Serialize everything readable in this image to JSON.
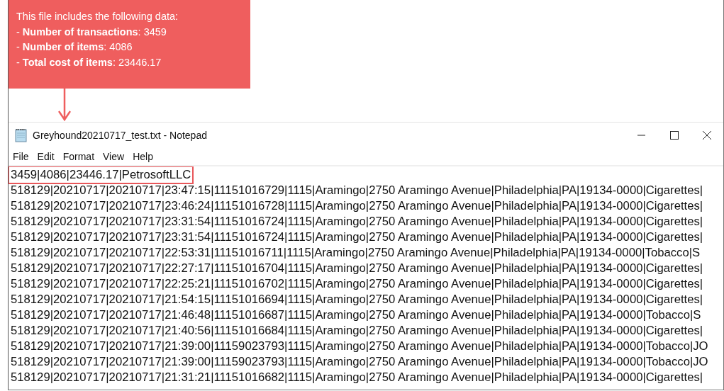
{
  "callout": {
    "heading": "This file includes the following data:",
    "items": [
      "- **Number of transactions**: 3459",
      "- **Number of items**: 4086",
      "- **Total cost of items**: 23446.17"
    ]
  },
  "window": {
    "title": "Greyhound20210717_test.txt - Notepad"
  },
  "menu": [
    "File",
    "Edit",
    "Format",
    "View",
    "Help"
  ],
  "lines": [
    {
      "text": "3459|4086|23446.17|PetrosoftLLC",
      "highlighted": true
    },
    {
      "text": "518129|20210717|20210717|23:47:15|11151016729|1115|Aramingo|2750 Aramingo Avenue|Philadelphia|PA|19134-0000|Cigarettes|",
      "highlighted": false
    },
    {
      "text": "518129|20210717|20210717|23:46:24|11151016728|1115|Aramingo|2750 Aramingo Avenue|Philadelphia|PA|19134-0000|Cigarettes|",
      "highlighted": false
    },
    {
      "text": "518129|20210717|20210717|23:31:54|11151016724|1115|Aramingo|2750 Aramingo Avenue|Philadelphia|PA|19134-0000|Cigarettes|",
      "highlighted": false
    },
    {
      "text": "518129|20210717|20210717|23:31:54|11151016724|1115|Aramingo|2750 Aramingo Avenue|Philadelphia|PA|19134-0000|Cigarettes|",
      "highlighted": false
    },
    {
      "text": "518129|20210717|20210717|22:53:31|11151016711|1115|Aramingo|2750 Aramingo Avenue|Philadelphia|PA|19134-0000|Tobacco|S",
      "highlighted": false
    },
    {
      "text": "518129|20210717|20210717|22:27:17|11151016704|1115|Aramingo|2750 Aramingo Avenue|Philadelphia|PA|19134-0000|Cigarettes|",
      "highlighted": false
    },
    {
      "text": "518129|20210717|20210717|22:25:21|11151016702|1115|Aramingo|2750 Aramingo Avenue|Philadelphia|PA|19134-0000|Cigarettes|",
      "highlighted": false
    },
    {
      "text": "518129|20210717|20210717|21:54:15|11151016694|1115|Aramingo|2750 Aramingo Avenue|Philadelphia|PA|19134-0000|Cigarettes|",
      "highlighted": false
    },
    {
      "text": "518129|20210717|20210717|21:46:48|11151016687|1115|Aramingo|2750 Aramingo Avenue|Philadelphia|PA|19134-0000|Tobacco|S",
      "highlighted": false
    },
    {
      "text": "518129|20210717|20210717|21:40:56|11151016684|1115|Aramingo|2750 Aramingo Avenue|Philadelphia|PA|19134-0000|Cigarettes|",
      "highlighted": false
    },
    {
      "text": "518129|20210717|20210717|21:39:00|11159023793|1115|Aramingo|2750 Aramingo Avenue|Philadelphia|PA|19134-0000|Tobacco|JO",
      "highlighted": false
    },
    {
      "text": "518129|20210717|20210717|21:39:00|11159023793|1115|Aramingo|2750 Aramingo Avenue|Philadelphia|PA|19134-0000|Tobacco|JO",
      "highlighted": false
    },
    {
      "text": "518129|20210717|20210717|21:31:21|11151016682|1115|Aramingo|2750 Aramingo Avenue|Philadelphia|PA|19134-0000|Cigarettes|",
      "highlighted": false
    }
  ]
}
